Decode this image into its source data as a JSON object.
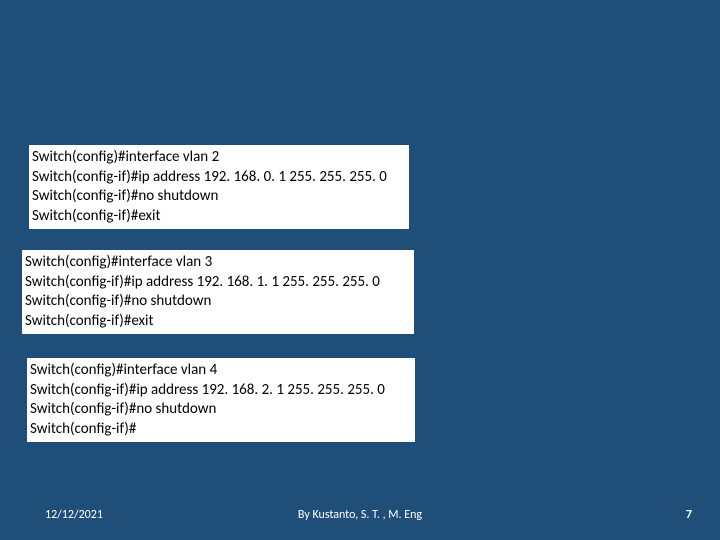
{
  "blocks": [
    {
      "lines": [
        "Switch(config)#interface vlan 2",
        "Switch(config-if)#ip address 192. 168. 0. 1 255. 255. 255. 0",
        "Switch(config-if)#no shutdown",
        "Switch(config-if)#exit"
      ]
    },
    {
      "lines": [
        "Switch(config)#interface vlan 3",
        "Switch(config-if)#ip address 192. 168. 1. 1 255. 255. 255. 0",
        "Switch(config-if)#no shutdown",
        "Switch(config-if)#exit"
      ]
    },
    {
      "lines": [
        "Switch(config)#interface vlan 4",
        "Switch(config-if)#ip address 192. 168. 2. 1 255. 255. 255. 0",
        "Switch(config-if)#no shutdown",
        "Switch(config-if)#"
      ]
    }
  ],
  "footer": {
    "date": "12/12/2021",
    "author": "By Kustanto, S. T. , M. Eng",
    "page": "7"
  }
}
